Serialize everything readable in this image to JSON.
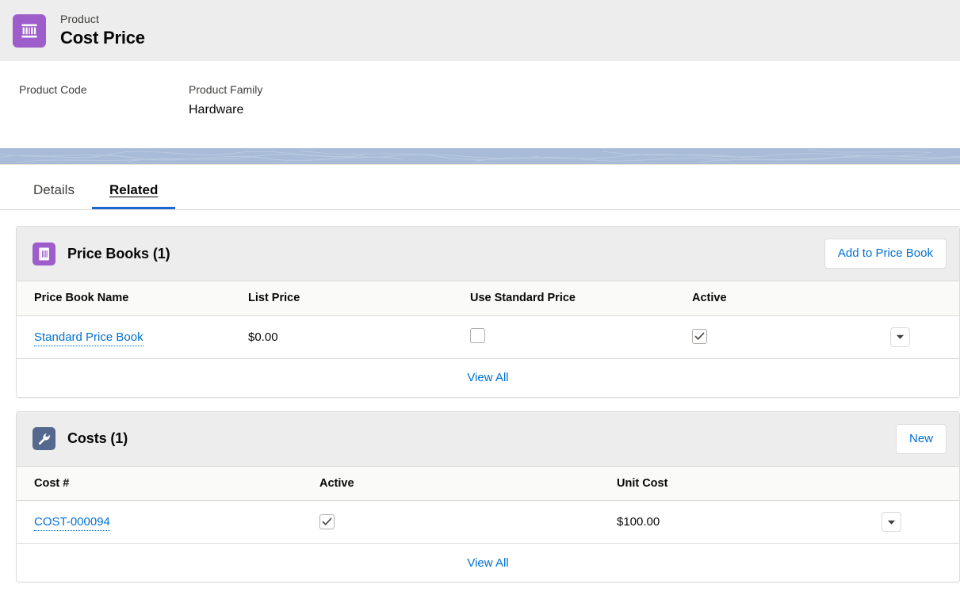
{
  "record_header": {
    "icon": "product-icon",
    "object_type": "Product",
    "record_name": "Cost Price",
    "icon_color": "#9d5ecb"
  },
  "highlights": {
    "fields": [
      {
        "label": "Product Code",
        "value": ""
      },
      {
        "label": "Product Family",
        "value": "Hardware"
      }
    ]
  },
  "tabs": {
    "items": [
      {
        "label": "Details",
        "active": false
      },
      {
        "label": "Related",
        "active": true
      }
    ],
    "active_color": "#1b66d0"
  },
  "related_lists": [
    {
      "icon": "price-book-icon",
      "icon_color": "#9d5ecb",
      "title": "Price Books (1)",
      "action_label": "Add to Price Book",
      "columns": [
        "Price Book Name",
        "List Price",
        "Use Standard Price",
        "Active",
        ""
      ],
      "rows": [
        {
          "name": "Standard Price Book",
          "list_price": "$0.00",
          "use_standard_price": false,
          "active": true,
          "row_menu": "chevron-down-icon"
        }
      ],
      "view_all_label": "View All"
    },
    {
      "icon": "wrench-icon",
      "icon_color": "#54698d",
      "title": "Costs (1)",
      "action_label": "New",
      "columns": [
        "Cost #",
        "Active",
        "Unit Cost",
        ""
      ],
      "rows": [
        {
          "name": "COST-000094",
          "active": true,
          "unit_cost": "$100.00",
          "row_menu": "chevron-down-icon"
        }
      ],
      "view_all_label": "View All"
    }
  ]
}
